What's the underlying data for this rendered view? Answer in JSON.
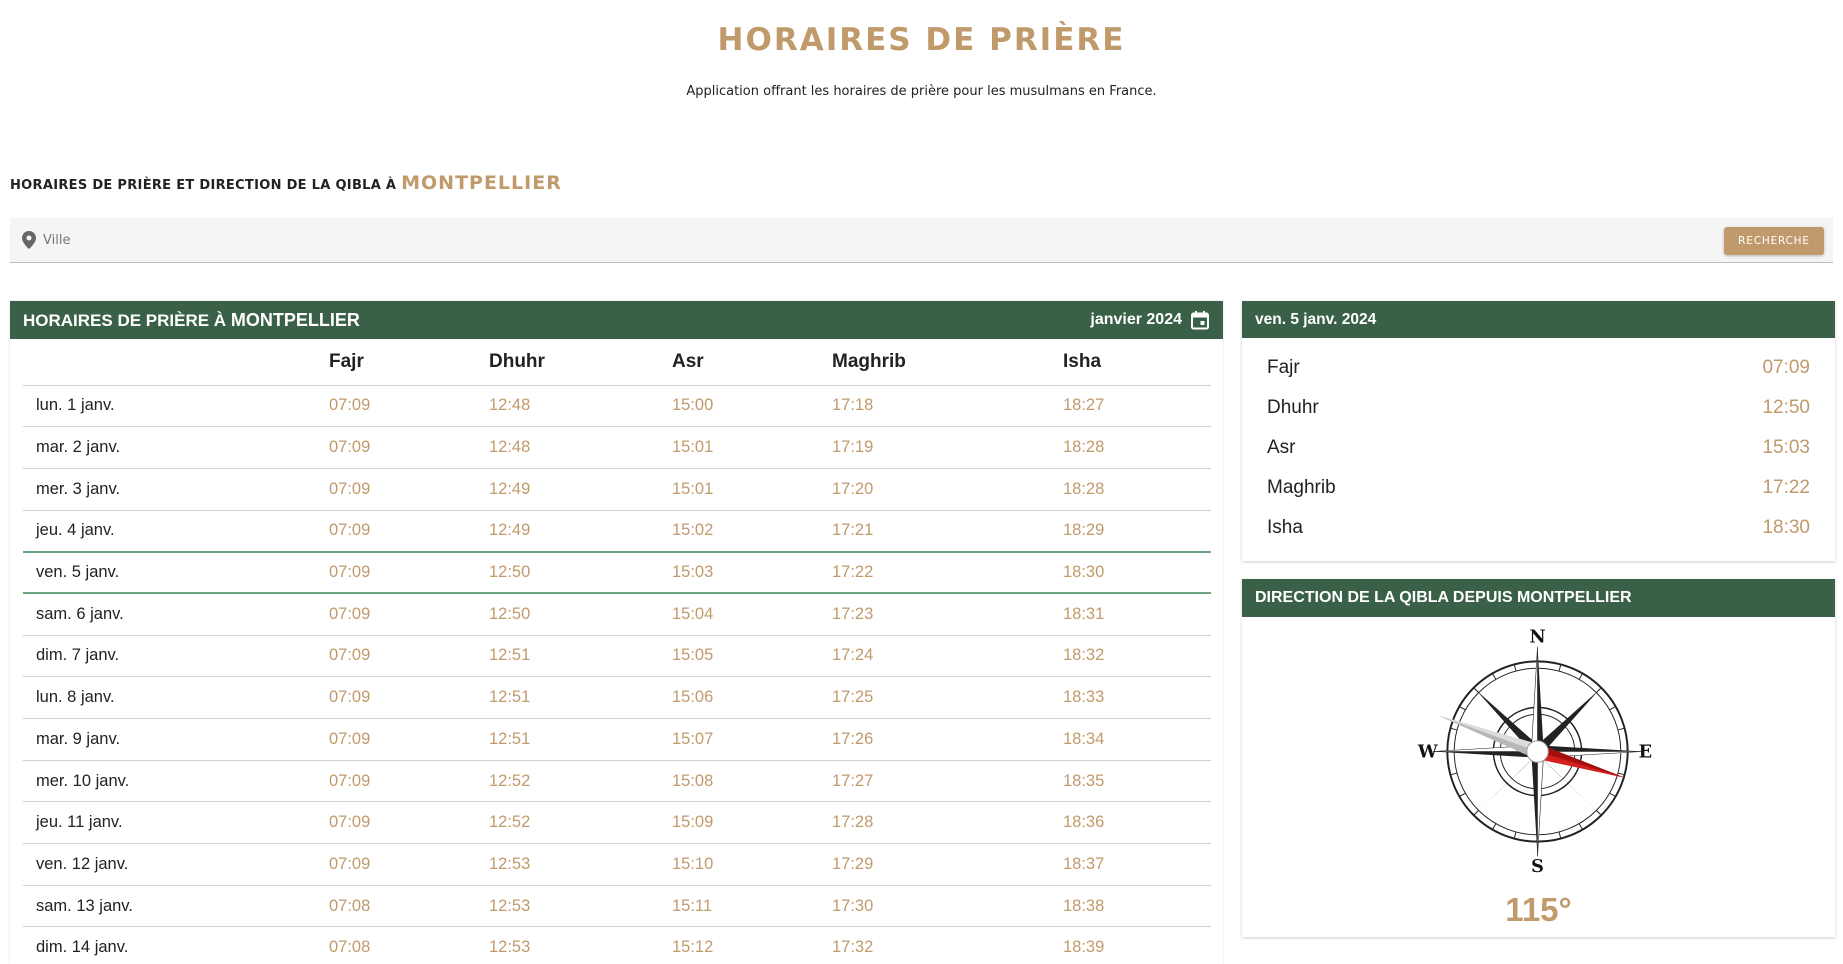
{
  "header": {
    "title": "HORAIRES DE PRIÈRE",
    "subtitle": "Application offrant les horaires de prière pour les musulmans en France."
  },
  "section": {
    "heading_prefix": "HORAIRES DE PRIÈRE ET DIRECTION DE LA QIBLA À",
    "city": "MONTPELLIER"
  },
  "search": {
    "icon": "location-pin-icon",
    "placeholder": "Ville",
    "button_label": "RECHERCHE"
  },
  "monthly_table": {
    "title_prefix": "HORAIRES DE PRIÈRE À",
    "city": "MONTPELLIER",
    "month": "janvier 2024",
    "month_icon": "calendar-icon",
    "columns": [
      "Fajr",
      "Dhuhr",
      "Asr",
      "Maghrib",
      "Isha"
    ],
    "highlighted_row": 4,
    "rows": [
      {
        "day": "lun. 1 janv.",
        "times": [
          "07:09",
          "12:48",
          "15:00",
          "17:18",
          "18:27"
        ]
      },
      {
        "day": "mar. 2 janv.",
        "times": [
          "07:09",
          "12:48",
          "15:01",
          "17:19",
          "18:28"
        ]
      },
      {
        "day": "mer. 3 janv.",
        "times": [
          "07:09",
          "12:49",
          "15:01",
          "17:20",
          "18:28"
        ]
      },
      {
        "day": "jeu. 4 janv.",
        "times": [
          "07:09",
          "12:49",
          "15:02",
          "17:21",
          "18:29"
        ]
      },
      {
        "day": "ven. 5 janv.",
        "times": [
          "07:09",
          "12:50",
          "15:03",
          "17:22",
          "18:30"
        ]
      },
      {
        "day": "sam. 6 janv.",
        "times": [
          "07:09",
          "12:50",
          "15:04",
          "17:23",
          "18:31"
        ]
      },
      {
        "day": "dim. 7 janv.",
        "times": [
          "07:09",
          "12:51",
          "15:05",
          "17:24",
          "18:32"
        ]
      },
      {
        "day": "lun. 8 janv.",
        "times": [
          "07:09",
          "12:51",
          "15:06",
          "17:25",
          "18:33"
        ]
      },
      {
        "day": "mar. 9 janv.",
        "times": [
          "07:09",
          "12:51",
          "15:07",
          "17:26",
          "18:34"
        ]
      },
      {
        "day": "mer. 10 janv.",
        "times": [
          "07:09",
          "12:52",
          "15:08",
          "17:27",
          "18:35"
        ]
      },
      {
        "day": "jeu. 11 janv.",
        "times": [
          "07:09",
          "12:52",
          "15:09",
          "17:28",
          "18:36"
        ]
      },
      {
        "day": "ven. 12 janv.",
        "times": [
          "07:09",
          "12:53",
          "15:10",
          "17:29",
          "18:37"
        ]
      },
      {
        "day": "sam. 13 janv.",
        "times": [
          "07:08",
          "12:53",
          "15:11",
          "17:30",
          "18:38"
        ]
      },
      {
        "day": "dim. 14 janv.",
        "times": [
          "07:08",
          "12:53",
          "15:12",
          "17:32",
          "18:39"
        ]
      }
    ]
  },
  "today": {
    "date": "ven. 5 janv. 2024",
    "prayers": [
      {
        "name": "Fajr",
        "time": "07:09"
      },
      {
        "name": "Dhuhr",
        "time": "12:50"
      },
      {
        "name": "Asr",
        "time": "15:03"
      },
      {
        "name": "Maghrib",
        "time": "17:22"
      },
      {
        "name": "Isha",
        "time": "18:30"
      }
    ]
  },
  "qibla": {
    "title": "DIRECTION DE LA QIBLA DEPUIS MONTPELLIER",
    "compass_icon": "compass-icon",
    "directions": {
      "n": "N",
      "s": "S",
      "e": "E",
      "w": "W"
    },
    "degrees": "115°",
    "angle": 115
  },
  "colors": {
    "accent": "#c19a6b",
    "header_green": "#3a6147",
    "highlight_line": "#6aa480"
  }
}
